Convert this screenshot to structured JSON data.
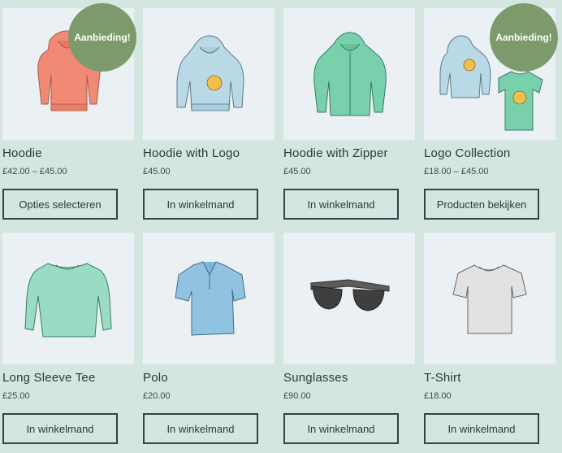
{
  "products": [
    {
      "name": "Hoodie",
      "price": "£42.00 – £45.00",
      "button": "Opties selecteren",
      "badge": "Aanbieding!",
      "icon": "hoodie-red-icon"
    },
    {
      "name": "Hoodie with Logo",
      "price": "£45.00",
      "button": "In winkelmand",
      "badge": "",
      "icon": "hoodie-logo-icon"
    },
    {
      "name": "Hoodie with Zipper",
      "price": "£45.00",
      "button": "In winkelmand",
      "badge": "",
      "icon": "hoodie-zipper-icon"
    },
    {
      "name": "Logo Collection",
      "price": "£18.00 – £45.00",
      "button": "Producten bekijken",
      "badge": "Aanbieding!",
      "icon": "logo-collection-icon"
    },
    {
      "name": "Long Sleeve Tee",
      "price": "£25.00",
      "button": "In winkelmand",
      "badge": "",
      "icon": "long-sleeve-tee-icon"
    },
    {
      "name": "Polo",
      "price": "£20.00",
      "button": "In winkelmand",
      "badge": "",
      "icon": "polo-icon"
    },
    {
      "name": "Sunglasses",
      "price": "£90.00",
      "button": "In winkelmand",
      "badge": "",
      "icon": "sunglasses-icon"
    },
    {
      "name": "T-Shirt",
      "price": "£18.00",
      "button": "In winkelmand",
      "badge": "",
      "icon": "tshirt-icon"
    }
  ],
  "colors": {
    "background": "#d4e6df",
    "thumb_bg": "#eaf0f4",
    "badge": "#7c9a6b",
    "border": "#33444a"
  }
}
